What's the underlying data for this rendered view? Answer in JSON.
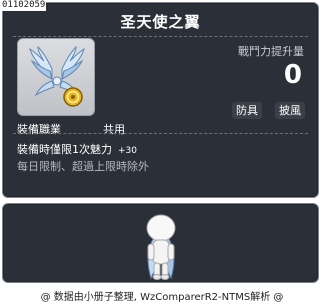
{
  "item_id": "01102059",
  "tooltip": {
    "title": "圣天使之翼",
    "power": {
      "label": "戰鬥力提升量",
      "value": "0"
    },
    "tags": [
      "防具",
      "披風"
    ],
    "job": {
      "label": "裝備職業",
      "value": "共用"
    },
    "effect": {
      "text": "裝備時僅限1次魅力",
      "bonus": "+30"
    },
    "limit_text": "每日限制、超過上限時除外"
  },
  "footer": "@ 数据由小册子整理, WzComparerR2-NTMS解析 @",
  "icons": {
    "item": "angel-wings-icon",
    "coin": "gold-coin-icon"
  },
  "colors": {
    "panel_bg": "#2b2f37",
    "panel_border": "#7d838d",
    "wing_blue": "#a7c7e8"
  }
}
